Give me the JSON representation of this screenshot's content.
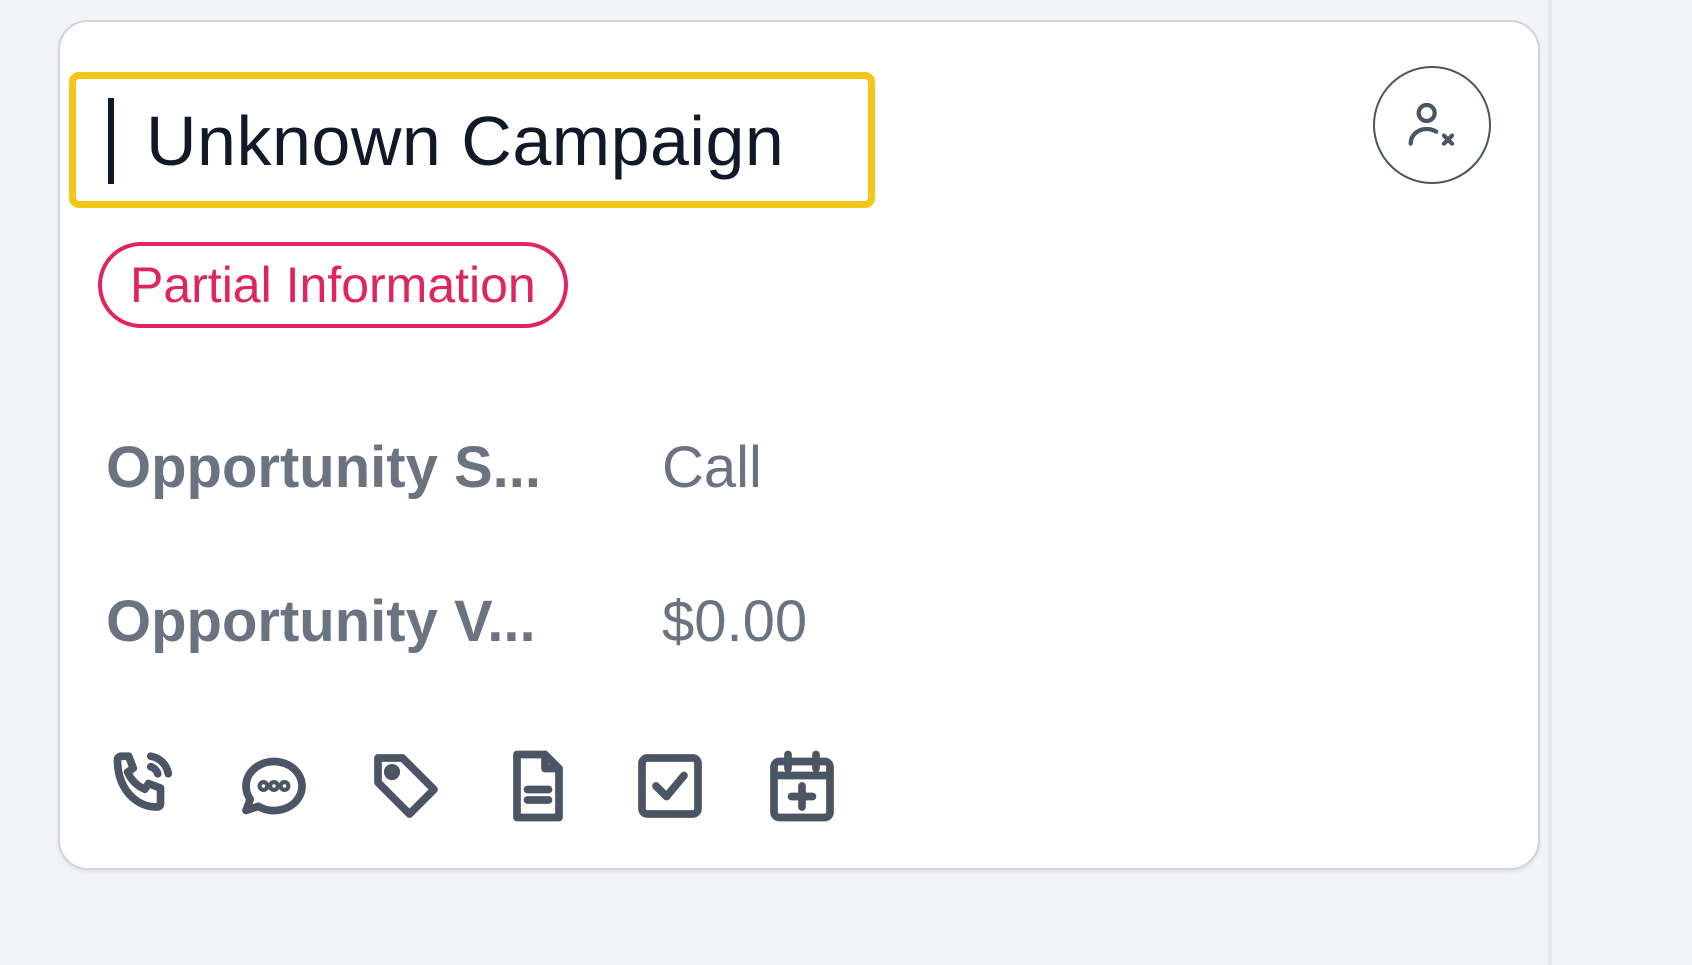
{
  "card": {
    "title": "Unknown Campaign",
    "badge": "Partial Information",
    "fields": [
      {
        "label": "Opportunity S...",
        "value": "Call"
      },
      {
        "label": "Opportunity V...",
        "value": "$0.00"
      }
    ],
    "header_action_icon": "user-remove-icon",
    "actions": [
      {
        "icon": "phone-call-icon"
      },
      {
        "icon": "chat-bubble-icon"
      },
      {
        "icon": "tag-icon"
      },
      {
        "icon": "document-icon"
      },
      {
        "icon": "checkbox-icon"
      },
      {
        "icon": "calendar-add-icon"
      }
    ]
  },
  "colors": {
    "badge": "#e0245e",
    "highlight": "#f5c518",
    "text_primary": "#111827",
    "text_muted": "#6b7280",
    "icon": "#4b5563"
  }
}
